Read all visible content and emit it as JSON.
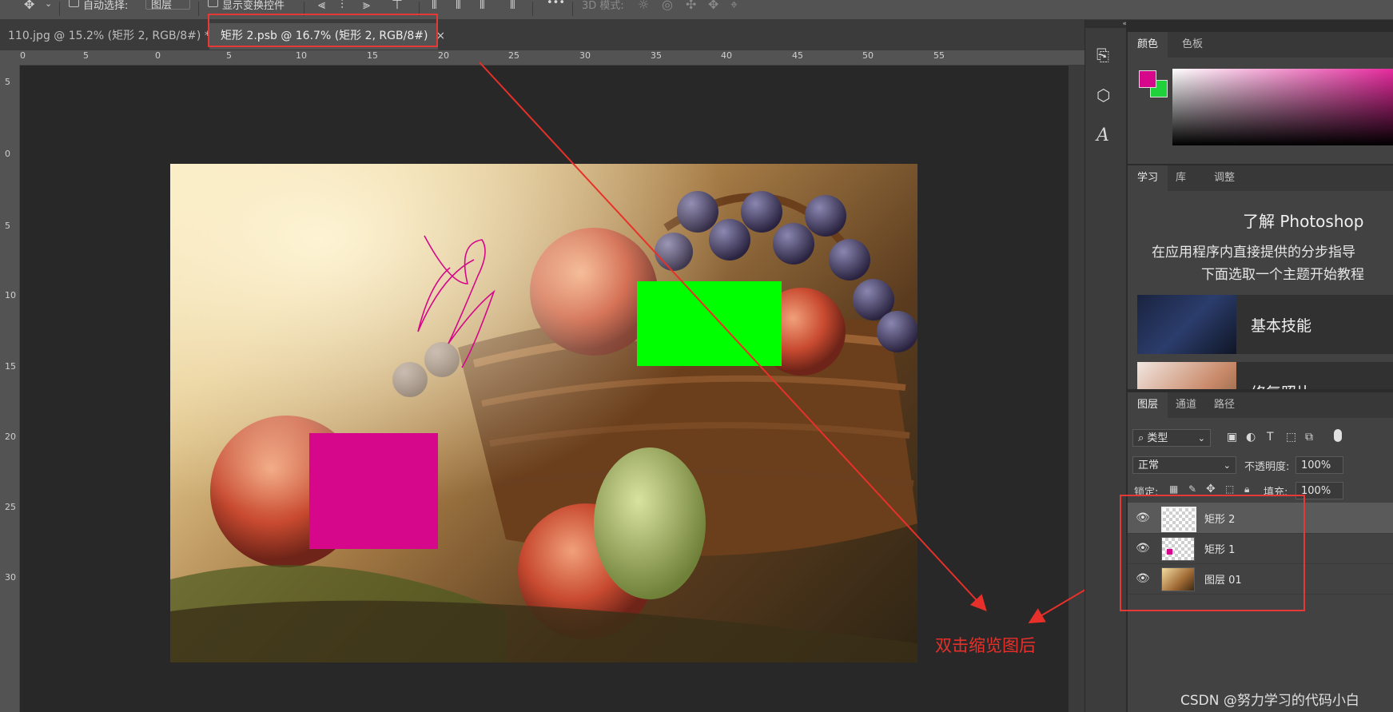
{
  "options_bar": {
    "auto_select_label": "自动选择:",
    "auto_select_value": "图层",
    "show_transform_label": "显示变换控件",
    "mode_3d_label": "3D 模式:",
    "more": "•••"
  },
  "tabs": [
    {
      "label": "110.jpg @ 15.2% (矩形 2, RGB/8#) *",
      "close": "×"
    },
    {
      "label": "矩形 2.psb @ 16.7% (矩形 2, RGB/8#)",
      "close": "×"
    }
  ],
  "ruler_h": {
    "labels": [
      "0",
      "5",
      "0",
      "5",
      "10",
      "15",
      "20",
      "25",
      "30",
      "35",
      "40",
      "45",
      "50",
      "55"
    ]
  },
  "ruler_v": {
    "labels": [
      "5",
      "0",
      "5",
      "10",
      "15",
      "20",
      "25",
      "30"
    ]
  },
  "color_panel": {
    "tabs": [
      "颜色",
      "色板"
    ],
    "foreground": "#d6078a",
    "background": "#1fd13a"
  },
  "learn_panel": {
    "tabs": [
      "学习",
      "库",
      "调整"
    ],
    "title": "了解 Photoshop",
    "desc1": "在应用程序内直接提供的分步指导",
    "desc2": "下面选取一个主题开始教程",
    "items": [
      {
        "label": "基本技能"
      },
      {
        "label": "修复照片"
      }
    ]
  },
  "layers_panel": {
    "tabs": [
      "图层",
      "通道",
      "路径"
    ],
    "filter": "类型",
    "blend_mode": "正常",
    "opacity_label": "不透明度:",
    "opacity_value": "100%",
    "lock_label": "锁定:",
    "fill_label": "填充:",
    "fill_value": "100%",
    "layers": [
      {
        "name": "矩形 2",
        "selected": true
      },
      {
        "name": "矩形 1",
        "selected": false
      },
      {
        "name": "图层 01",
        "selected": false
      }
    ]
  },
  "annotation": {
    "text": "双击缩览图后",
    "color": "#e8302a"
  },
  "watermark": "CSDN @努力学习的代码小白",
  "colors": {
    "magenta": "#d6078a",
    "green": "#00ff00"
  }
}
